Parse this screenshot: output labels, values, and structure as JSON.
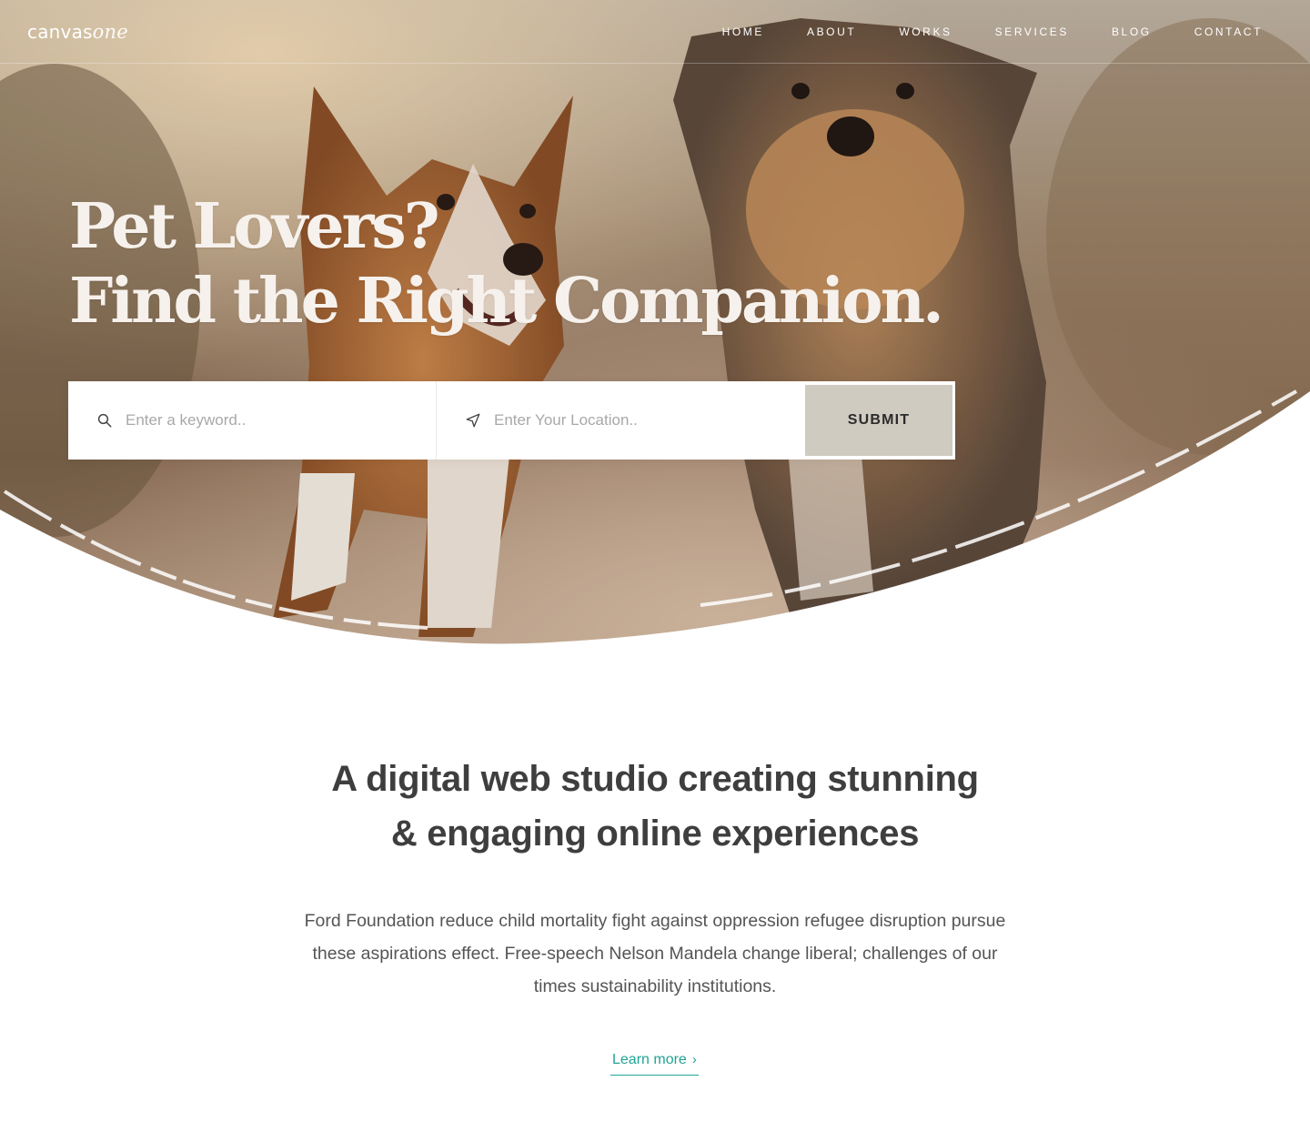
{
  "brand": {
    "logo_main": "canvas",
    "logo_accent": "one"
  },
  "nav": {
    "items": [
      {
        "label": "HOME"
      },
      {
        "label": "ABOUT"
      },
      {
        "label": "WORKS"
      },
      {
        "label": "SERVICES"
      },
      {
        "label": "BLOG"
      },
      {
        "label": "CONTACT"
      }
    ]
  },
  "hero": {
    "headline_line1": "Pet Lovers?",
    "headline_line2": "Find the Right Companion.",
    "image_subject": "two dogs running on a sunlit path",
    "search": {
      "keyword_placeholder": "Enter a keyword..",
      "location_placeholder": "Enter Your Location..",
      "submit_label": "SUBMIT"
    }
  },
  "intro": {
    "title_line1": "A digital web studio creating stunning",
    "title_line2": "& engaging online experiences",
    "description_line1": "Ford Foundation reduce child mortality fight against oppression refugee disruption pursue",
    "description_line2": "these aspirations effect. Free-speech Nelson Mandela change liberal; challenges of our",
    "description_line3": "times sustainability institutions.",
    "link_label": "Learn more"
  },
  "colors": {
    "accent": "#21a494",
    "submit_bg": "#cfcbc0",
    "heading": "#3e3e3e"
  }
}
